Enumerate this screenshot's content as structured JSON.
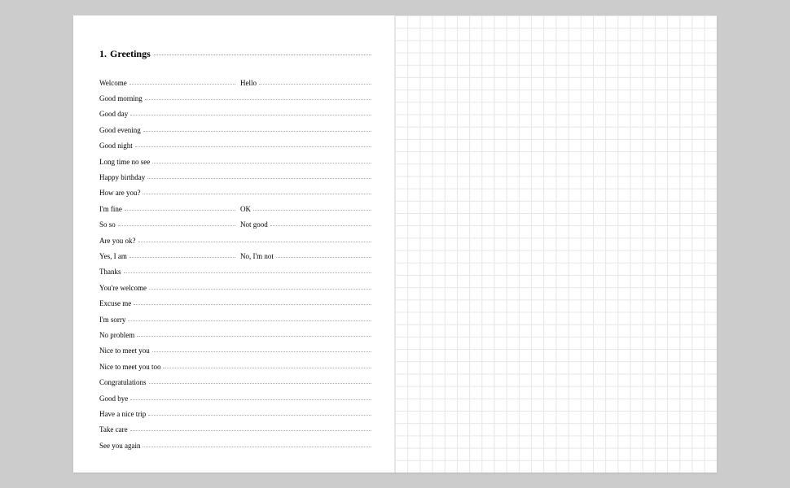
{
  "section": {
    "number": "1.",
    "title": "Greetings"
  },
  "rows": [
    {
      "left": "Welcome",
      "right": "Hello"
    },
    {
      "left": "Good morning"
    },
    {
      "left": "Good day"
    },
    {
      "left": "Good evening"
    },
    {
      "left": "Good night"
    },
    {
      "left": "Long time no see"
    },
    {
      "left": "Happy birthday"
    },
    {
      "left": "How are you?"
    },
    {
      "left": "I'm fine",
      "right": "OK"
    },
    {
      "left": "So so",
      "right": "Not good"
    },
    {
      "left": "Are you ok?"
    },
    {
      "left": "Yes, I am",
      "right": "No, I'm not"
    },
    {
      "left": "Thanks"
    },
    {
      "left": "You're welcome"
    },
    {
      "left": "Excuse me"
    },
    {
      "left": "I'm sorry"
    },
    {
      "left": "No problem"
    },
    {
      "left": "Nice to meet you"
    },
    {
      "left": "Nice to meet you too"
    },
    {
      "left": "Congratulations"
    },
    {
      "left": "Good bye"
    },
    {
      "left": "Have a nice trip"
    },
    {
      "left": "Take care"
    },
    {
      "left": "See you again"
    }
  ]
}
